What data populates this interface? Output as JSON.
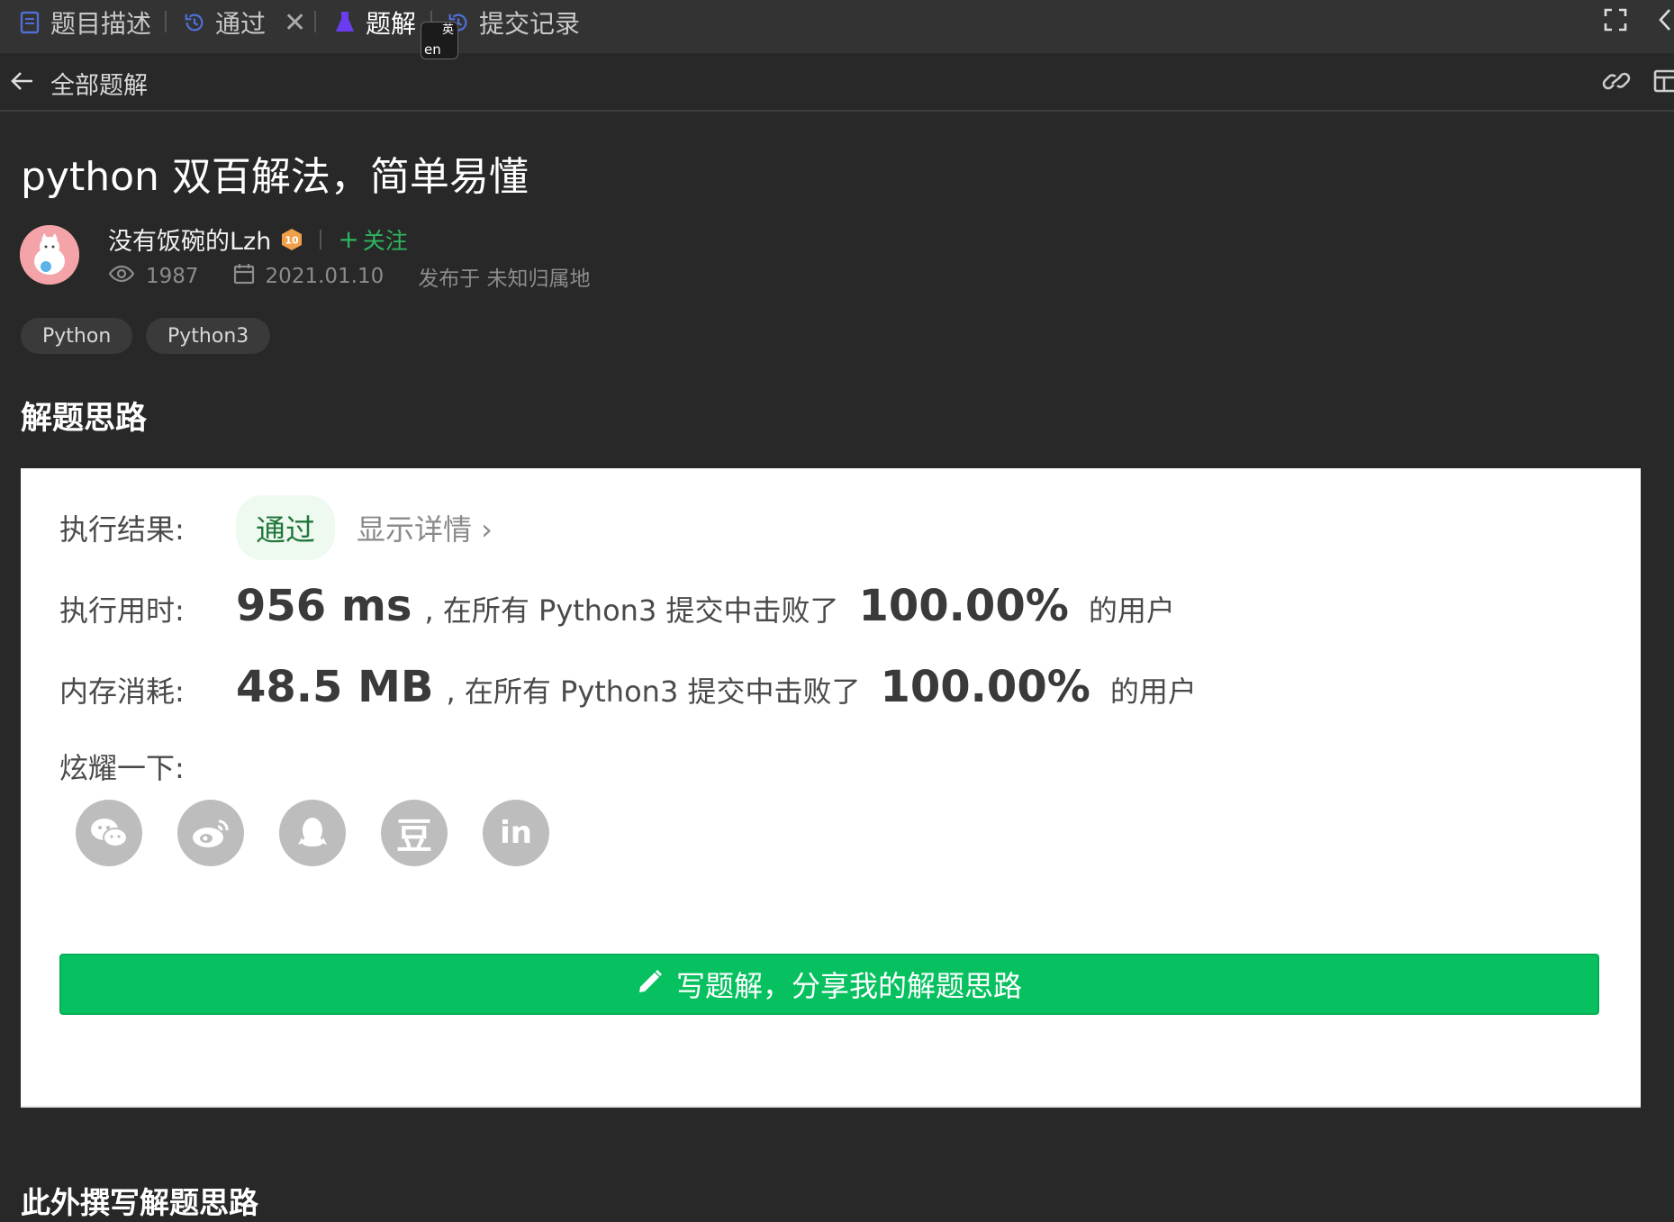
{
  "tabs": [
    {
      "label": "题目描述",
      "icon": "document-icon"
    },
    {
      "label": "通过",
      "icon": "history-icon"
    },
    {
      "label": "题解",
      "icon": "flask-icon"
    },
    {
      "label": "提交记录",
      "icon": "history-icon"
    }
  ],
  "ime": {
    "top": "英",
    "bottom": "en"
  },
  "subheader": {
    "back_icon": "arrow-left-icon",
    "crumb": "全部题解"
  },
  "article": {
    "title": "python 双百解法，简单易懂",
    "author": "没有饭碗的Lzh",
    "level": "10",
    "follow": "关注",
    "views": "1987",
    "date": "2021.01.10",
    "location": "发布于 未知归属地",
    "tags": [
      "Python",
      "Python3"
    ],
    "section_heading": "解题思路",
    "next_heading": "此外撰写解题思路"
  },
  "result": {
    "status_label": "执行结果:",
    "status": "通过",
    "details": "显示详情 ›",
    "time_label": "执行用时:",
    "time_value": "956 ms",
    "time_mid": ", 在所有 Python3 提交中击败了",
    "time_pct": "100.00%",
    "time_tail": "的用户",
    "mem_label": "内存消耗:",
    "mem_value": "48.5 MB",
    "mem_mid": ", 在所有 Python3 提交中击败了",
    "mem_pct": "100.00%",
    "mem_tail": "的用户",
    "share_label": "炫耀一下:",
    "share_icons": [
      "wechat-icon",
      "weibo-icon",
      "qq-icon",
      "douban-icon",
      "linkedin-icon"
    ],
    "douban_glyph": "豆",
    "linkedin_glyph": "in",
    "write_button": "写题解，分享我的解题思路"
  },
  "colors": {
    "accent_green": "#07c160",
    "follow_green": "#2db55d",
    "active_tab_icon": "#6a3cf0"
  }
}
